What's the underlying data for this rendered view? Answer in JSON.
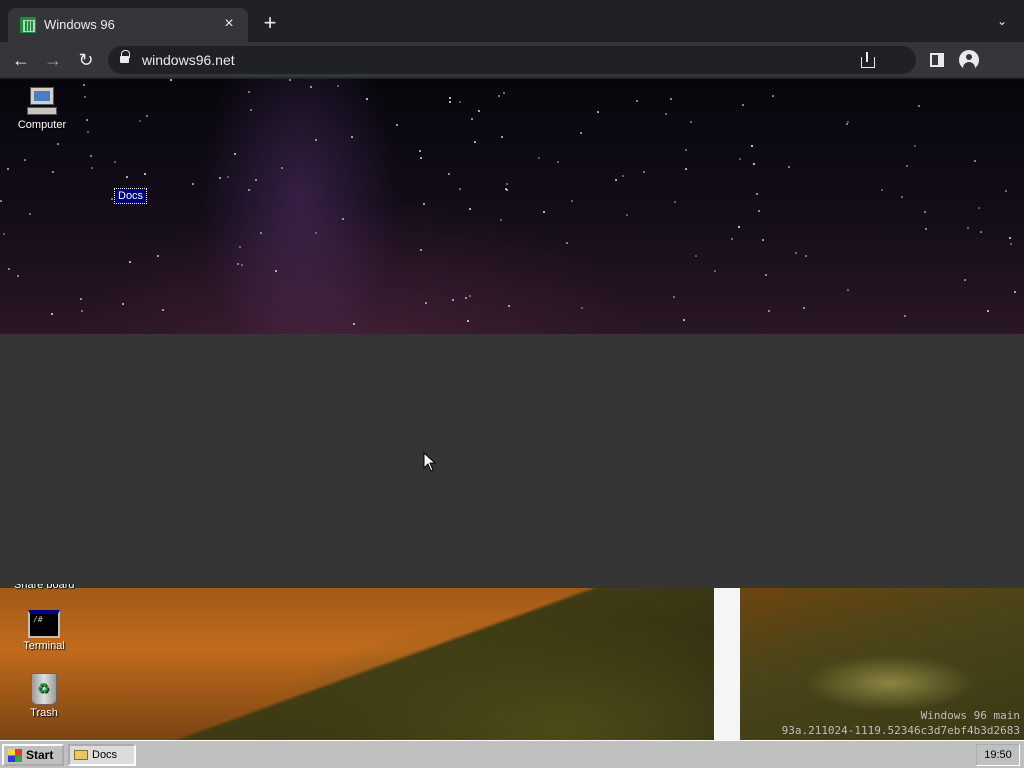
{
  "browser": {
    "tab_title": "Windows 96",
    "tab_close": "×",
    "new_tab": "+",
    "tab_menu": "⌄",
    "url": "windows96.net",
    "back": "←",
    "forward": "→",
    "reload": "↻"
  },
  "desktop": {
    "icons": [
      {
        "label": "Computer",
        "icon": "computer-icon"
      },
      {
        "label": "Terminal",
        "icon": "terminal-icon"
      },
      {
        "label": "Trash",
        "icon": "trash-icon"
      }
    ],
    "selected_label": "Docs",
    "partial_label": "Share board",
    "watermark_line1": "Windows 96 main",
    "watermark_line2": "93a.211024-1119.52346c3d7ebf4b3d2683"
  },
  "taskbar": {
    "start_label": "Start",
    "task_items": [
      {
        "label": "Docs",
        "icon": "folder-icon"
      }
    ],
    "clock": "19:50"
  }
}
